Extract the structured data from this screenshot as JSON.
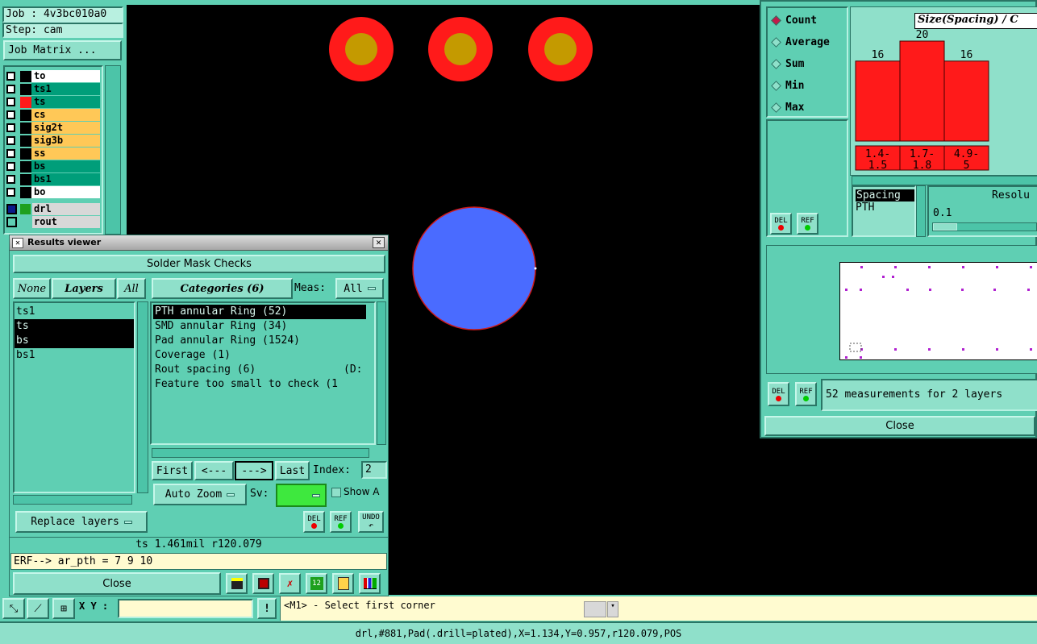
{
  "job": {
    "job_label": "Job : 4v3bc010a0",
    "step_label": "Step: cam",
    "job_matrix_button": "Job Matrix ..."
  },
  "layers": [
    {
      "name": "to",
      "color": "#ffffff",
      "swatch": "#000000"
    },
    {
      "name": "ts1",
      "color": "#009e7a",
      "swatch": "#000000"
    },
    {
      "name": "ts",
      "color": "#009e7a",
      "swatch": "#ff1a1a"
    },
    {
      "name": "cs",
      "color": "#ffc857",
      "swatch": "#000000"
    },
    {
      "name": "sig2t",
      "color": "#ffc857",
      "swatch": "#000000"
    },
    {
      "name": "sig3b",
      "color": "#ffc857",
      "swatch": "#000000"
    },
    {
      "name": "ss",
      "color": "#ffc857",
      "swatch": "#000000"
    },
    {
      "name": "bs",
      "color": "#009e7a",
      "swatch": "#000000"
    },
    {
      "name": "bs1",
      "color": "#009e7a",
      "swatch": "#000000"
    },
    {
      "name": "bo",
      "color": "#ffffff",
      "swatch": "#000000"
    }
  ],
  "drill_layers": [
    {
      "name": "drl"
    },
    {
      "name": "rout"
    }
  ],
  "results_viewer": {
    "title": "Results viewer",
    "header": "Solder Mask Checks",
    "none_label": "None",
    "layers_label": "Layers",
    "all_label": "All",
    "categories_label": "Categories (6)",
    "meas_label": "Meas:",
    "meas_value": "All",
    "layer_items": [
      "ts1",
      "ts",
      "bs",
      "bs1"
    ],
    "category_items": [
      "PTH annular Ring (52)",
      "SMD annular Ring (34)",
      "Pad annular Ring (1524)",
      "Coverage (1)",
      "Rout spacing (6)",
      "Feature too small to check (1"
    ],
    "rout_extra": "(D:",
    "first": "First",
    "prev": "<---",
    "next": "--->",
    "last": "Last",
    "index_label": "Index:",
    "index_value": "2",
    "auto_zoom": "Auto Zoom",
    "sv_label": "Sv:",
    "show_label": "Show A",
    "replace_layers": "Replace layers",
    "del": "DEL",
    "ref": "REF",
    "undo": "UNDO",
    "status": "ts 1.461mil  r120.079",
    "erf_line": "ERF--> ar_pth = 7 9 10",
    "close": "Close"
  },
  "histogram": {
    "modes": [
      "Count",
      "Average",
      "Sum",
      "Min",
      "Max"
    ],
    "selected_mode": "Count",
    "title": "Size(Spacing) / C",
    "del": "DEL",
    "ref": "REF",
    "spacing_label": "Spacing",
    "pth_label": "PTH",
    "resolution_label": "Resolu",
    "resolution_value": "0.1",
    "measurements_text": "52 measurements for 2 layers",
    "close": "Close"
  },
  "chart_data": {
    "type": "bar",
    "categories": [
      "1.4-\n1.5",
      "1.7-\n1.8",
      "4.9-\n5"
    ],
    "values": [
      16,
      20,
      16
    ],
    "title": "Size(Spacing) / C",
    "xlabel": "",
    "ylabel": "",
    "ylim": [
      0,
      20
    ]
  },
  "bottom": {
    "xy_label": "X Y :",
    "xy_value": "",
    "hint": "<M1> - Select first corner",
    "status_bar": "drl,#881,Pad(.drill=plated),X=1.134,Y=0.957,r120.079,POS"
  },
  "colors": {
    "accent": "#5fcfb3",
    "pad_outer": "#ff1a1a",
    "pad_inner": "#c49a00",
    "selected_pad": "#4a6bff",
    "bar": "#ff1a1a"
  }
}
